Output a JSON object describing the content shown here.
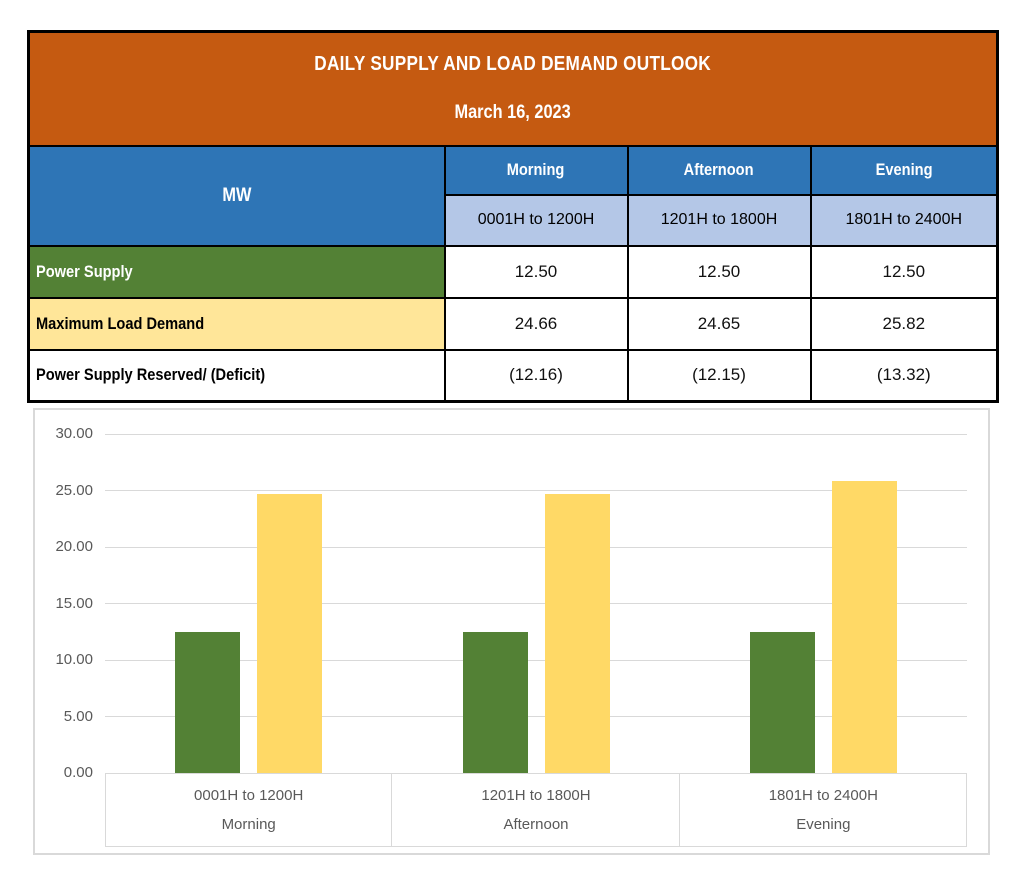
{
  "header": {
    "title": "DAILY SUPPLY AND LOAD DEMAND OUTLOOK",
    "date": "March 16, 2023"
  },
  "table": {
    "unit_label": "MW",
    "columns": [
      {
        "period": "Morning",
        "hours": "0001H to 1200H"
      },
      {
        "period": "Afternoon",
        "hours": "1201H to 1800H"
      },
      {
        "period": "Evening",
        "hours": "1801H to 2400H"
      }
    ],
    "rows": [
      {
        "label": "Power Supply",
        "values": [
          "12.50",
          "12.50",
          "12.50"
        ]
      },
      {
        "label": "Maximum Load Demand",
        "values": [
          "24.66",
          "24.65",
          "25.82"
        ]
      },
      {
        "label": "Power Supply Reserved/ (Deficit)",
        "values": [
          "(12.16)",
          "(12.15)",
          "(13.32)"
        ]
      }
    ]
  },
  "chart_data": {
    "type": "bar",
    "categories": [
      "0001H to 1200H",
      "1201H to 1800H",
      "1801H to 2400H"
    ],
    "category_groups": [
      "Morning",
      "Afternoon",
      "Evening"
    ],
    "series": [
      {
        "name": "Power Supply",
        "color": "#538135",
        "values": [
          12.5,
          12.5,
          12.5
        ]
      },
      {
        "name": "Maximum Load Demand",
        "color": "#FFD966",
        "values": [
          24.66,
          24.65,
          25.82
        ]
      }
    ],
    "title": "",
    "xlabel": "",
    "ylabel": "",
    "ylim": [
      0,
      30
    ],
    "ytick_step": 5,
    "ytick_decimals": 2,
    "grid": true,
    "legend": "none"
  },
  "colors": {
    "header_bg": "#C55A11",
    "header_text": "#FFFFFF",
    "period_header_bg": "#2E75B6",
    "hours_header_bg": "#B4C7E7",
    "power_supply_bg": "#538135",
    "max_load_bg": "#FFE699",
    "bar_supply": "#538135",
    "bar_demand": "#FFD966",
    "table_border": "#000000",
    "chart_border": "#D9D9D9",
    "chart_text": "#595959"
  }
}
